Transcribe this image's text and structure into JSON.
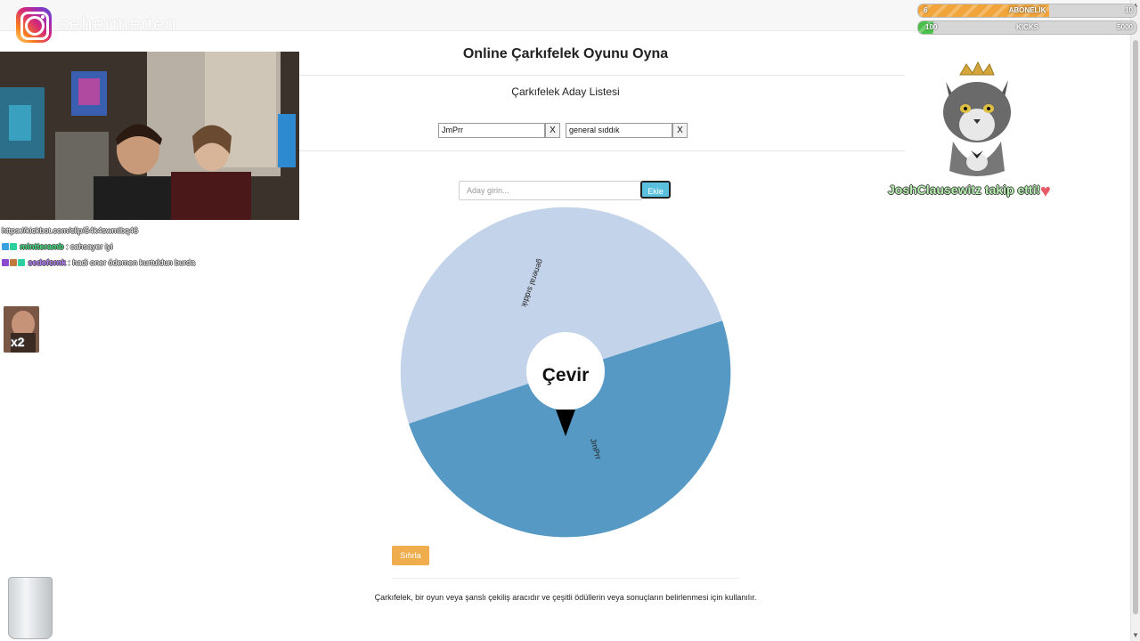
{
  "page": {
    "title": "Online Çarkıfelek Oyunu Oyna",
    "subtitle": "Çarkıfelek Aday Listesi",
    "description": "Çarkıfelek, bir oyun veya şanslı çekiliş aracıdır ve çeşitli ödüllerin veya sonuçların belirlenmesi için kullanılır."
  },
  "candidates": [
    {
      "value": "JmPrr",
      "remove_label": "X"
    },
    {
      "value": "general sıddık",
      "remove_label": "X"
    }
  ],
  "add_form": {
    "placeholder": "Aday girin...",
    "button_label": "Ekle"
  },
  "wheel": {
    "center_label": "Çevir",
    "segments": [
      {
        "label": "general sıddık",
        "color": "#c3d3ea"
      },
      {
        "label": "JmPrr",
        "color": "#5599c4"
      }
    ]
  },
  "reset_label": "Sıfırla",
  "overlay": {
    "instagram_handle": "sehermeden",
    "chat": [
      {
        "user": "",
        "text": "https://kickbot.com/clip/54k4swmlbq46"
      },
      {
        "user": "mintteramb",
        "text": " : cahsayer iyi"
      },
      {
        "user": "sedefcrnk",
        "text": " : hadi oner ödemen kurtuldun burda"
      }
    ],
    "alert_user": "JoshClausewitz",
    "alert_text": " takip etti!",
    "avatar_multiplier": "x2",
    "goal_bars": [
      {
        "label": "ABONELİK",
        "start": "6",
        "end": "10",
        "progress": 0.6,
        "color": "#f0a43a"
      },
      {
        "label": "KICKS",
        "start": "100",
        "end": "5000",
        "progress": 0.02,
        "color": "#48c04a"
      }
    ]
  }
}
